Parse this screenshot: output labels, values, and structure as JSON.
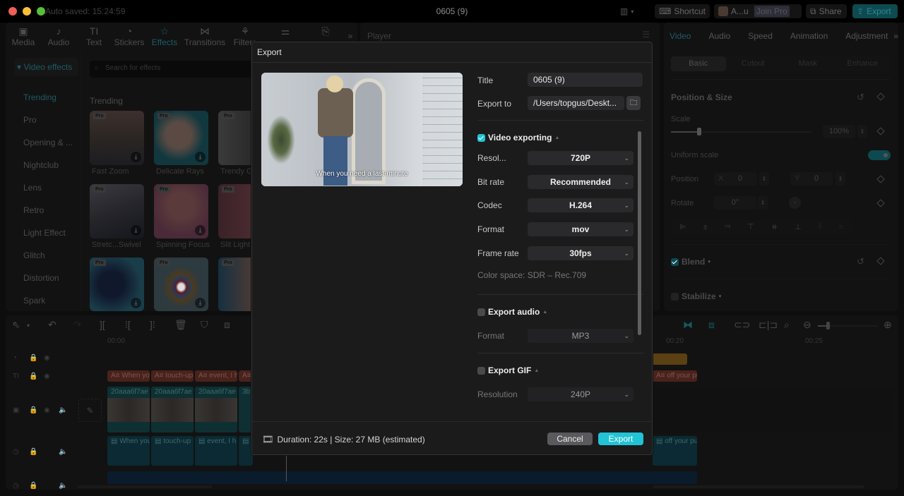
{
  "titlebar": {
    "autosave": "Auto saved: 15:24:59",
    "title": "0605 (9)",
    "shortcut": "Shortcut",
    "user": "A...u",
    "join_pro": "Join Pro",
    "share": "Share",
    "export": "Export"
  },
  "toolbar": {
    "items": [
      {
        "label": "Media",
        "icon": "media-icon",
        "glyph": "▣"
      },
      {
        "label": "Audio",
        "icon": "audio-icon",
        "glyph": "♪"
      },
      {
        "label": "Text",
        "icon": "text-icon",
        "glyph": "TI"
      },
      {
        "label": "Stickers",
        "icon": "stickers-icon",
        "glyph": "◔"
      },
      {
        "label": "Effects",
        "icon": "effects-icon",
        "glyph": "☆"
      },
      {
        "label": "Transitions",
        "icon": "transitions-icon",
        "glyph": "⋈"
      },
      {
        "label": "Filters",
        "icon": "filters-icon",
        "glyph": "⚘"
      },
      {
        "label": "Adjustment",
        "icon": "adjustment-icon",
        "glyph": "⚌"
      },
      {
        "label": "Templates",
        "icon": "templates-icon",
        "glyph": "⎘"
      }
    ],
    "active": "Effects",
    "more": "»"
  },
  "sidebar": {
    "header": "▾ Video effects",
    "items": [
      "Trending",
      "Pro",
      "Opening & ...",
      "Nightclub",
      "Lens",
      "Retro",
      "Light Effect",
      "Glitch",
      "Distortion",
      "Spark"
    ],
    "active": "Trending"
  },
  "effects": {
    "search_placeholder": "Search for effects",
    "section": "Trending",
    "badge": "Pro",
    "items": [
      "Fast Zoom",
      "Delicate Rays",
      "Trendy G",
      "Stretc...Swivel",
      "Spinning Focus",
      "Slit Light",
      "",
      "",
      ""
    ]
  },
  "player": {
    "title": "Player"
  },
  "right_panel": {
    "tabs": [
      "Video",
      "Audio",
      "Speed",
      "Animation",
      "Adjustment"
    ],
    "active_tab": "Video",
    "more": "»",
    "segments": [
      "Basic",
      "Cutout",
      "Mask",
      "Enhance"
    ],
    "active_segment": "Basic",
    "position_size": "Position & Size",
    "scale_label": "Scale",
    "scale_value": "100%",
    "scale_fraction": 0.2,
    "uniform_scale": "Uniform scale",
    "uniform_scale_on": true,
    "position_label": "Position",
    "x_label": "X",
    "x_value": "0",
    "y_label": "Y",
    "y_value": "0",
    "rotate_label": "Rotate",
    "rotate_value": "0°",
    "blend": "Blend",
    "blend_checked": true,
    "stabilize": "Stabilize",
    "stabilize_checked": false
  },
  "timeline": {
    "ruler": [
      "00:00",
      "00:20",
      "00:25"
    ],
    "text_clips": [
      "When you",
      "touch-up",
      "event, I h",
      "",
      "off your pu"
    ],
    "video_clips": [
      "20aaa6f7ae",
      "20aaa6f7ae",
      "20aaa6f7ae",
      "3b"
    ],
    "audio_clips": [
      "When you",
      "touch-up",
      "event, I h",
      "",
      "off your pu"
    ]
  },
  "dialog": {
    "title": "Export",
    "subtitle_caption": "When you need a last-minute",
    "title_label": "Title",
    "title_value": "0605 (9)",
    "export_to_label": "Export to",
    "export_to_value": "/Users/topgus/Deskt...",
    "video_section": "Video exporting",
    "video_checked": true,
    "resolution_label": "Resol...",
    "resolution_value": "720P",
    "bitrate_label": "Bit rate",
    "bitrate_value": "Recommended",
    "codec_label": "Codec",
    "codec_value": "H.264",
    "format_label": "Format",
    "format_value": "mov",
    "framerate_label": "Frame rate",
    "framerate_value": "30fps",
    "color_space": "Color space: SDR – Rec.709",
    "audio_section": "Export audio",
    "audio_checked": false,
    "audio_format_label": "Format",
    "audio_format_value": "MP3",
    "gif_section": "Export GIF",
    "gif_checked": false,
    "gif_resolution_label": "Resolution",
    "gif_resolution_value": "240P",
    "footer_info": "Duration: 22s | Size: 27 MB (estimated)",
    "cancel": "Cancel",
    "export": "Export"
  },
  "colors": {
    "accent": "#22c3d6",
    "dim_accent": "#1e5b64",
    "dialog_bg": "#1b1b1c",
    "field_bg": "#2a2a2c"
  }
}
